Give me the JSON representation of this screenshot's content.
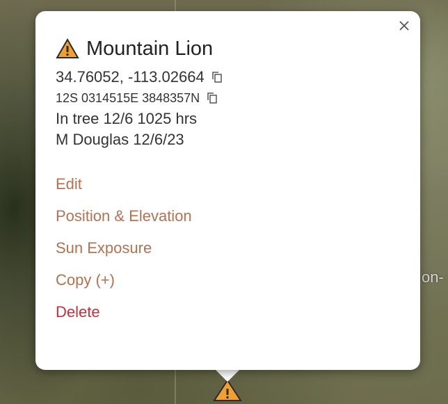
{
  "popup": {
    "title": "Mountain Lion",
    "coords_latlon": "34.76052, -113.02664",
    "coords_utm": "12S 0314515E 3848357N",
    "note": "In tree 12/6 1025 hrs",
    "author": "M Douglas 12/6/23"
  },
  "actions": {
    "edit": "Edit",
    "position": "Position & Elevation",
    "sun": "Sun Exposure",
    "copy": "Copy (+)",
    "delete": "Delete"
  },
  "map": {
    "label_fragment": "on-"
  },
  "colors": {
    "warning": "#f0a030",
    "action": "#b8704e",
    "delete": "#d12c36"
  },
  "icons": {
    "title": "warning-triangle-icon",
    "copy": "copy-icon",
    "close": "close-icon",
    "marker": "warning-marker-icon"
  }
}
